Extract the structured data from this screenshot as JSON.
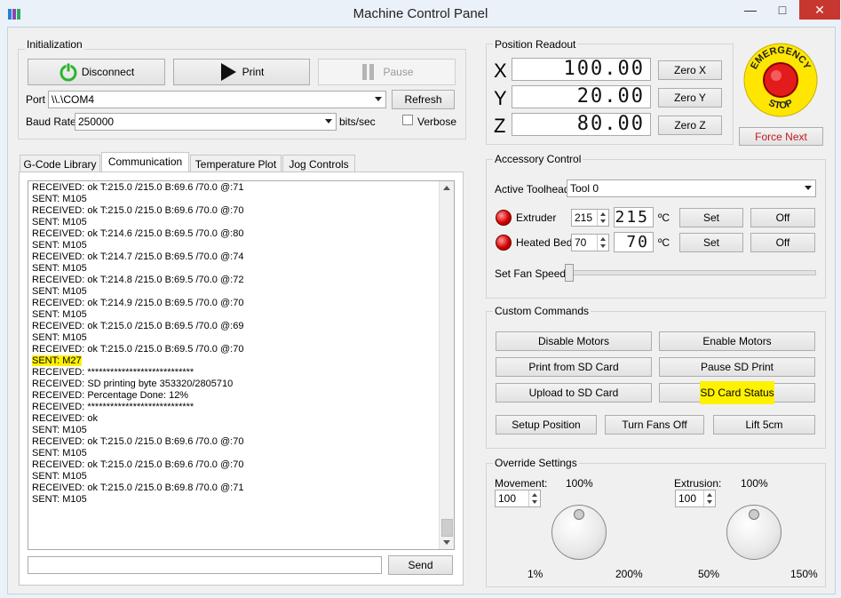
{
  "window": {
    "title": "Machine Control Panel",
    "minimize_symbol": "—",
    "maximize_symbol": "□",
    "close_symbol": "✕"
  },
  "initialization": {
    "group_label": "Initialization",
    "disconnect_label": "Disconnect",
    "print_label": "Print",
    "pause_label": "Pause",
    "port_label": "Port",
    "port_value": "\\\\.\\COM4",
    "refresh_label": "Refresh",
    "baud_label": "Baud Rate",
    "baud_value": "250000",
    "baud_unit": "bits/sec",
    "verbose_label": "Verbose"
  },
  "tabs": [
    "G-Code Library",
    "Communication",
    "Temperature Plot",
    "Jog Controls"
  ],
  "active_tab": "Communication",
  "log_lines": [
    "RECEIVED: ok T:215.0 /215.0 B:69.6 /70.0 @:71",
    "SENT: M105",
    "RECEIVED: ok T:215.0 /215.0 B:69.6 /70.0 @:70",
    "SENT: M105",
    "RECEIVED: ok T:214.6 /215.0 B:69.5 /70.0 @:80",
    "SENT: M105",
    "RECEIVED: ok T:214.7 /215.0 B:69.5 /70.0 @:74",
    "SENT: M105",
    "RECEIVED: ok T:214.8 /215.0 B:69.5 /70.0 @:72",
    "SENT: M105",
    "RECEIVED: ok T:214.9 /215.0 B:69.5 /70.0 @:70",
    "SENT: M105",
    "RECEIVED: ok T:215.0 /215.0 B:69.5 /70.0 @:69",
    "SENT: M105",
    "RECEIVED: ok T:215.0 /215.0 B:69.5 /70.0 @:70",
    "SENT: M27",
    "RECEIVED: ****************************",
    "RECEIVED: SD printing byte 353320/2805710",
    "RECEIVED: Percentage Done: 12%",
    "RECEIVED: ****************************",
    "RECEIVED: ok",
    "SENT: M105",
    "RECEIVED: ok T:215.0 /215.0 B:69.6 /70.0 @:70",
    "SENT: M105",
    "RECEIVED: ok T:215.0 /215.0 B:69.6 /70.0 @:70",
    "SENT: M105",
    "RECEIVED: ok T:215.0 /215.0 B:69.8 /70.0 @:71",
    "SENT: M105"
  ],
  "send_label": "Send",
  "command_input_value": "",
  "position": {
    "group_label": "Position Readout",
    "axes": [
      {
        "name": "X",
        "value": "100.00",
        "zero_label": "Zero X"
      },
      {
        "name": "Y",
        "value": "20.00",
        "zero_label": "Zero Y"
      },
      {
        "name": "Z",
        "value": "80.00",
        "zero_label": "Zero Z"
      }
    ]
  },
  "emergency": {
    "top_text": "EMERGENCY",
    "bottom_text": "STOP",
    "force_next_label": "Force Next",
    "color": "#e31b1b"
  },
  "accessory": {
    "group_label": "Accessory Control",
    "toolhead_label": "Active Toolhead",
    "toolhead_value": "Tool 0",
    "extruder_label": "Extruder",
    "extruder_set_value": "215",
    "extruder_display": "215",
    "bed_label": "Heated Bed",
    "bed_set_value": "70",
    "bed_display": "70",
    "unit": "ºC",
    "set_label": "Set",
    "off_label": "Off",
    "fan_label": "Set Fan Speed"
  },
  "custom": {
    "group_label": "Custom Commands",
    "buttons": [
      "Disable Motors",
      "Enable Motors",
      "Print from SD Card",
      "Pause SD Print",
      "Upload to SD Card",
      "SD Card Status"
    ],
    "bottom_buttons": [
      "Setup Position",
      "Turn Fans Off",
      "Lift 5cm"
    ]
  },
  "override": {
    "group_label": "Override Settings",
    "movement_label": "Movement:",
    "movement_value": "100",
    "movement_center": "100%",
    "movement_min": "1%",
    "movement_max": "200%",
    "extrusion_label": "Extrusion:",
    "extrusion_value": "100",
    "extrusion_center": "100%",
    "extrusion_min": "50%",
    "extrusion_max": "150%"
  }
}
